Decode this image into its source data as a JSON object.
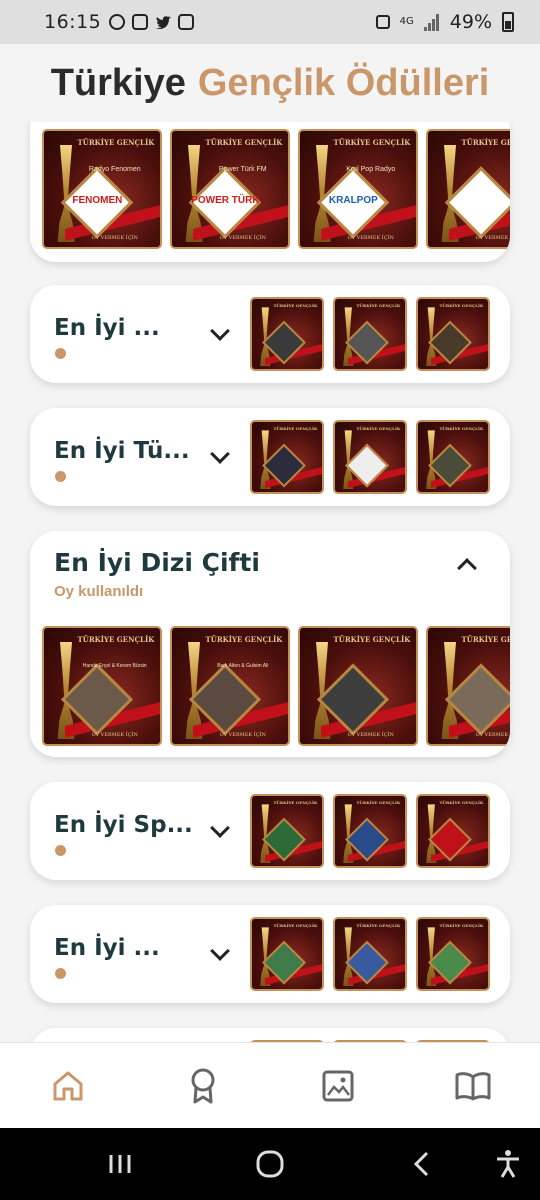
{
  "status_bar": {
    "time": "16:15",
    "network": "4G",
    "battery": "49%"
  },
  "header": {
    "title_part1": "Türkiye",
    "title_part2": "Gençlik Ödülleri"
  },
  "poster_text": {
    "header_line1": "TÜRKİYE GENÇLİK",
    "header_line2": "ÖDÜLLERİ",
    "footer": "OY VERMEK İÇİN"
  },
  "categories": [
    {
      "title": "",
      "expanded": true,
      "nominees": [
        {
          "caption": "Radyo Fenomen",
          "logo": "FENOMEN"
        },
        {
          "caption": "Power Türk FM",
          "logo": "POWER TÜRK"
        },
        {
          "caption": "Kral Pop Radyo",
          "logo": "KRALPOP"
        },
        {
          "caption": "",
          "logo": ""
        }
      ]
    },
    {
      "title": "En İyi ...",
      "expanded": false
    },
    {
      "title": "En İyi Tü...",
      "expanded": false
    },
    {
      "title": "En İyi Dizi Çifti",
      "expanded": true,
      "status": "Oy kullanıldı",
      "nominees": [
        {
          "caption": "Hande Erçel & Kerem Bürsin"
        },
        {
          "caption": "Bark Alten & Gulsim Ali"
        },
        {
          "caption": ""
        },
        {
          "caption": ""
        }
      ]
    },
    {
      "title": "En İyi Sp...",
      "expanded": false
    },
    {
      "title": "En İyi ...",
      "expanded": false
    }
  ],
  "bottom_nav": [
    {
      "icon": "home-icon",
      "active": true
    },
    {
      "icon": "award-icon",
      "active": false
    },
    {
      "icon": "gallery-icon",
      "active": false
    },
    {
      "icon": "book-icon",
      "active": false
    }
  ],
  "colors": {
    "accent": "#c9976a",
    "title": "#1f3a3f",
    "text_dark": "#2b2b2b"
  }
}
